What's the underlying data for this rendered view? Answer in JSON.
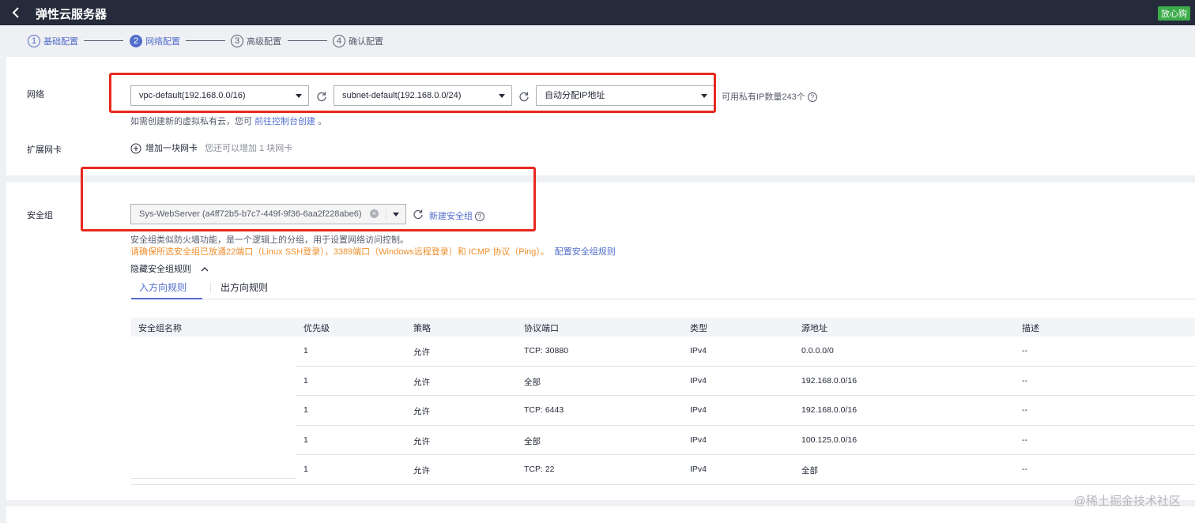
{
  "header": {
    "title": "弹性云服务器",
    "badge": "放心购"
  },
  "steps": [
    {
      "num": "1",
      "label": "基础配置"
    },
    {
      "num": "2",
      "label": "网络配置"
    },
    {
      "num": "3",
      "label": "高级配置"
    },
    {
      "num": "4",
      "label": "确认配置"
    }
  ],
  "network": {
    "label": "网络",
    "vpc_value": "vpc-default(192.168.0.0/16)",
    "subnet_value": "subnet-default(192.168.0.0/24)",
    "ip_value": "自动分配IP地址",
    "available_ip": "可用私有IP数量243个",
    "hint_prefix": "如需创建新的虚拟私有云，您可",
    "hint_link": "前往控制台创建",
    "hint_suffix": "。"
  },
  "nic": {
    "label": "扩展网卡",
    "add_label": "增加一块网卡",
    "add_hint": "您还可以增加 1 块网卡"
  },
  "security_group": {
    "label": "安全组",
    "selected": "Sys-WebServer (a4ff72b5-b7c7-449f-9f36-6aa2f228abe6)",
    "create_link": "新建安全组",
    "desc": "安全组类似防火墙功能，是一个逻辑上的分组，用于设置网络访问控制。",
    "warning": "请确保所选安全组已放通22端口（Linux SSH登录），3389端口（Windows远程登录）和 ICMP 协议（Ping）。",
    "config_link": "配置安全组规则",
    "hide_rules": "隐藏安全组规则",
    "tabs": [
      "入方向规则",
      "出方向规则"
    ]
  },
  "rules_table": {
    "headers": [
      "安全组名称",
      "优先级",
      "策略",
      "协议端口",
      "类型",
      "源地址",
      "描述"
    ],
    "rows": [
      [
        "",
        "1",
        "允许",
        "TCP: 30880",
        "IPv4",
        "0.0.0.0/0",
        "--"
      ],
      [
        "",
        "1",
        "允许",
        "全部",
        "IPv4",
        "192.168.0.0/16",
        "--"
      ],
      [
        "",
        "1",
        "允许",
        "TCP: 6443",
        "IPv4",
        "192.168.0.0/16",
        "--"
      ],
      [
        "",
        "1",
        "允许",
        "全部",
        "IPv4",
        "100.125.0.0/16",
        "--"
      ],
      [
        "",
        "1",
        "允许",
        "TCP: 22",
        "IPv4",
        "全部",
        "--"
      ]
    ]
  },
  "watermark": "@稀土掘金技术社区"
}
